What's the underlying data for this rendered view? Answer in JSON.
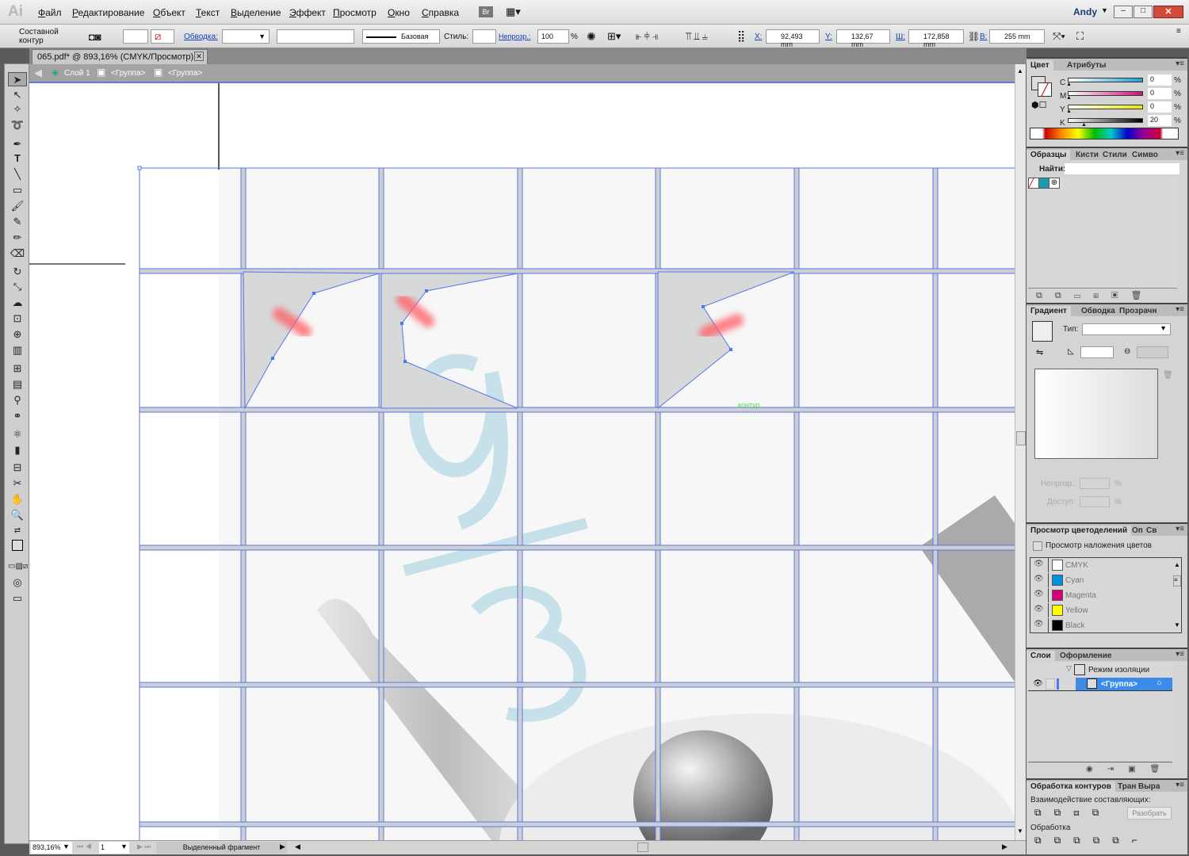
{
  "app": {
    "logo": "Ai",
    "user": "Andy"
  },
  "menu": [
    "Файл",
    "Редактирование",
    "Объект",
    "Текст",
    "Выделение",
    "Эффект",
    "Просмотр",
    "Окно",
    "Справка"
  ],
  "menu_extra": {
    "bridge": "Br"
  },
  "control": {
    "selection_type": "Составной контур",
    "stroke_label": "Обводка:",
    "brush": "Базовая",
    "style_label": "Стиль:",
    "opacity_label": "Непрозр.:",
    "opacity": "100",
    "pct": "%",
    "x_label": "X:",
    "x": "92,493 mm",
    "y_label": "Y:",
    "y": "132,67 mm",
    "w_label": "Ш:",
    "w": "172,858 mm",
    "h_label": "В:",
    "h": "255 mm"
  },
  "document": {
    "tab": "065.pdf* @ 893,16% (CMYK/Просмотр)",
    "breadcrumb": [
      "Слой 1",
      "<Группа>",
      "<Группа>"
    ],
    "path_label": "контур"
  },
  "status": {
    "zoom": "893,16%",
    "page": "1",
    "info": "Выделенный фрагмент"
  },
  "color_panel": {
    "tabs": [
      "Цвет",
      "Атрибуты"
    ],
    "channels": [
      {
        "label": "C",
        "value": "0",
        "color": "#1aa0e0"
      },
      {
        "label": "M",
        "value": "0",
        "color": "#d0107a"
      },
      {
        "label": "Y",
        "value": "0",
        "color": "#e8e800"
      },
      {
        "label": "K",
        "value": "20",
        "color": "#000000"
      }
    ],
    "pct": "%"
  },
  "swatches_panel": {
    "tabs": [
      "Образцы",
      "Кисти",
      "Стили",
      "Симво"
    ],
    "find_label": "Найти:"
  },
  "gradient_panel": {
    "tabs": [
      "Градиент",
      "Обводка",
      "Прозрачн"
    ],
    "type_label": "Тип:",
    "opacity_label": "Непрозр.:",
    "location_label": "Доступ:",
    "pct": "%"
  },
  "separations_panel": {
    "tabs": [
      "Просмотр цветоделений",
      "Оп",
      "Св"
    ],
    "overprint_label": "Просмотр наложения цветов",
    "inks": [
      {
        "name": "CMYK",
        "color": "#ffffff"
      },
      {
        "name": "Cyan",
        "color": "#0090e0"
      },
      {
        "name": "Magenta",
        "color": "#d4007a"
      },
      {
        "name": "Yellow",
        "color": "#ffff00"
      },
      {
        "name": "Black",
        "color": "#000000"
      }
    ]
  },
  "layers_panel": {
    "tabs": [
      "Слои",
      "Оформление"
    ],
    "items": [
      "Режим изоляции",
      "<Группа>"
    ]
  },
  "pathfinder_panel": {
    "tabs": [
      "Обработка контуров",
      "Тран",
      "Выра"
    ],
    "shape_modes_label": "Взаимодействие составляющих:",
    "expand_label": "Разобрать",
    "pathfinders_label": "Обработка"
  }
}
